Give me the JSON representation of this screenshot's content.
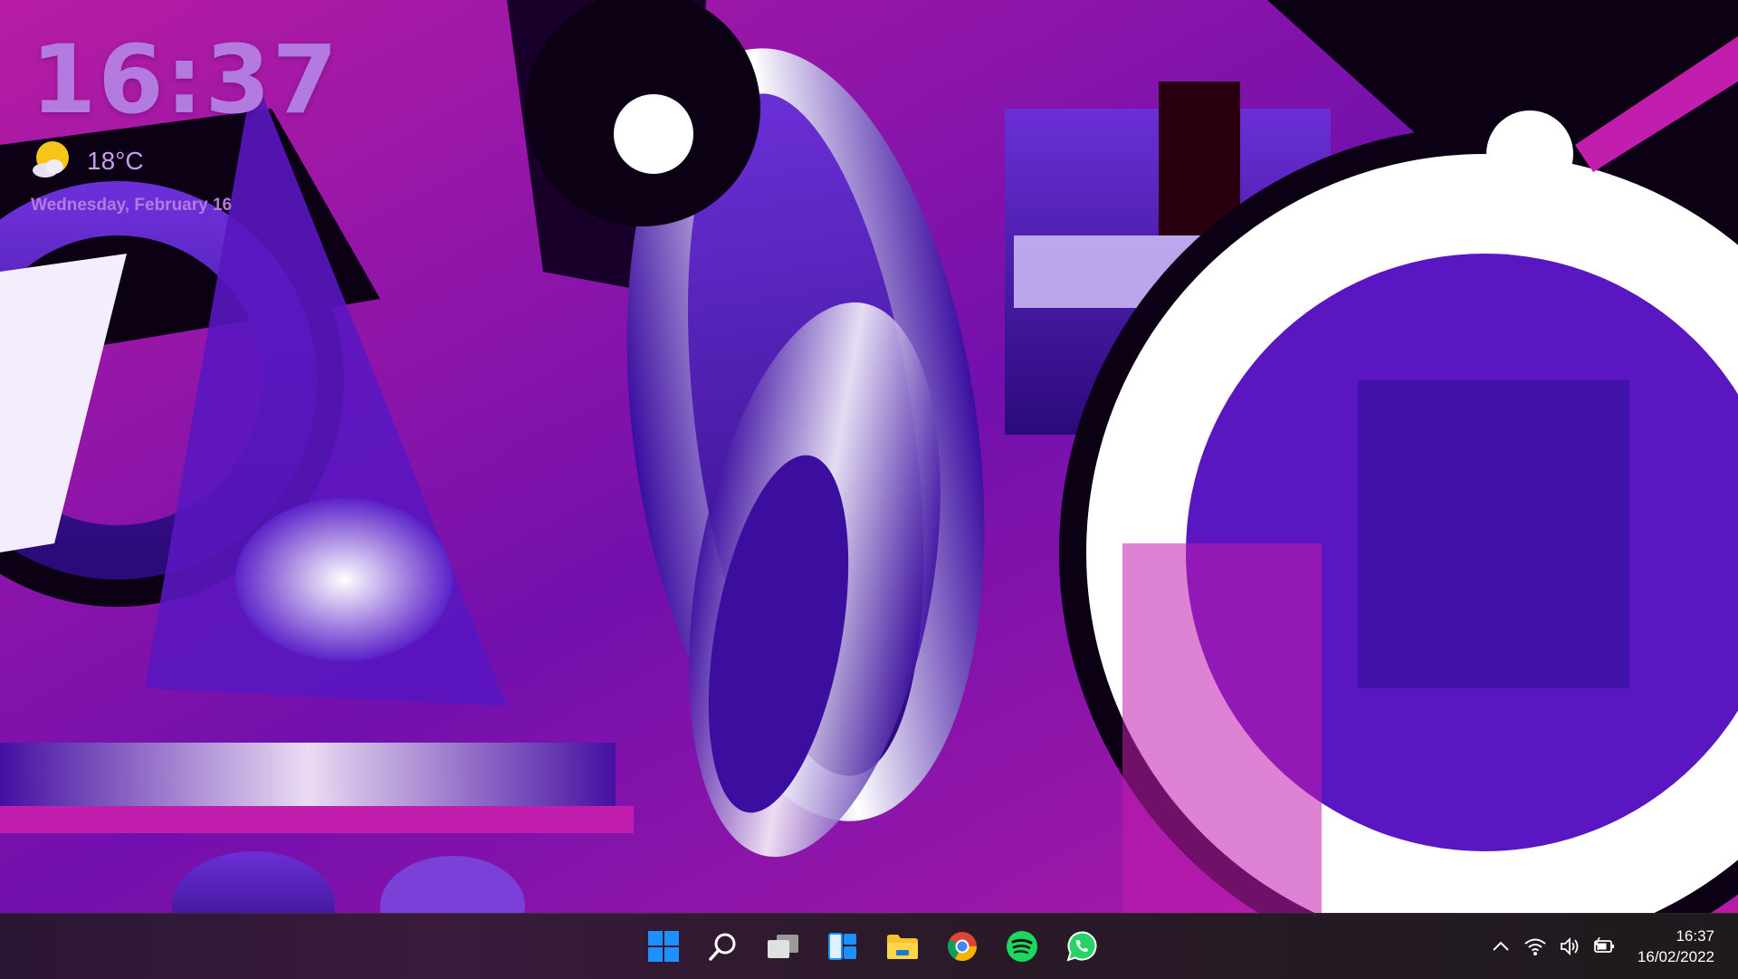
{
  "widget": {
    "time": "16:37",
    "temperature": "18°C",
    "weather_icon": "partly-sunny-icon",
    "date": "Wednesday, February 16"
  },
  "taskbar": {
    "pinned": [
      {
        "name": "Start",
        "icon": "windows-logo-icon"
      },
      {
        "name": "Search",
        "icon": "search-icon"
      },
      {
        "name": "Task View",
        "icon": "task-view-icon"
      },
      {
        "name": "Widgets",
        "icon": "widgets-icon"
      },
      {
        "name": "File Explorer",
        "icon": "folder-icon"
      },
      {
        "name": "Google Chrome",
        "icon": "chrome-icon"
      },
      {
        "name": "Spotify",
        "icon": "spotify-icon"
      },
      {
        "name": "WhatsApp",
        "icon": "whatsapp-icon"
      }
    ],
    "tray": {
      "time": "16:37",
      "date": "16/02/2022"
    }
  },
  "colors": {
    "accent_purple": "#b37adf",
    "windows_blue": "#1e90ff",
    "spotify_green": "#1ed760",
    "whatsapp_green": "#25d366"
  }
}
